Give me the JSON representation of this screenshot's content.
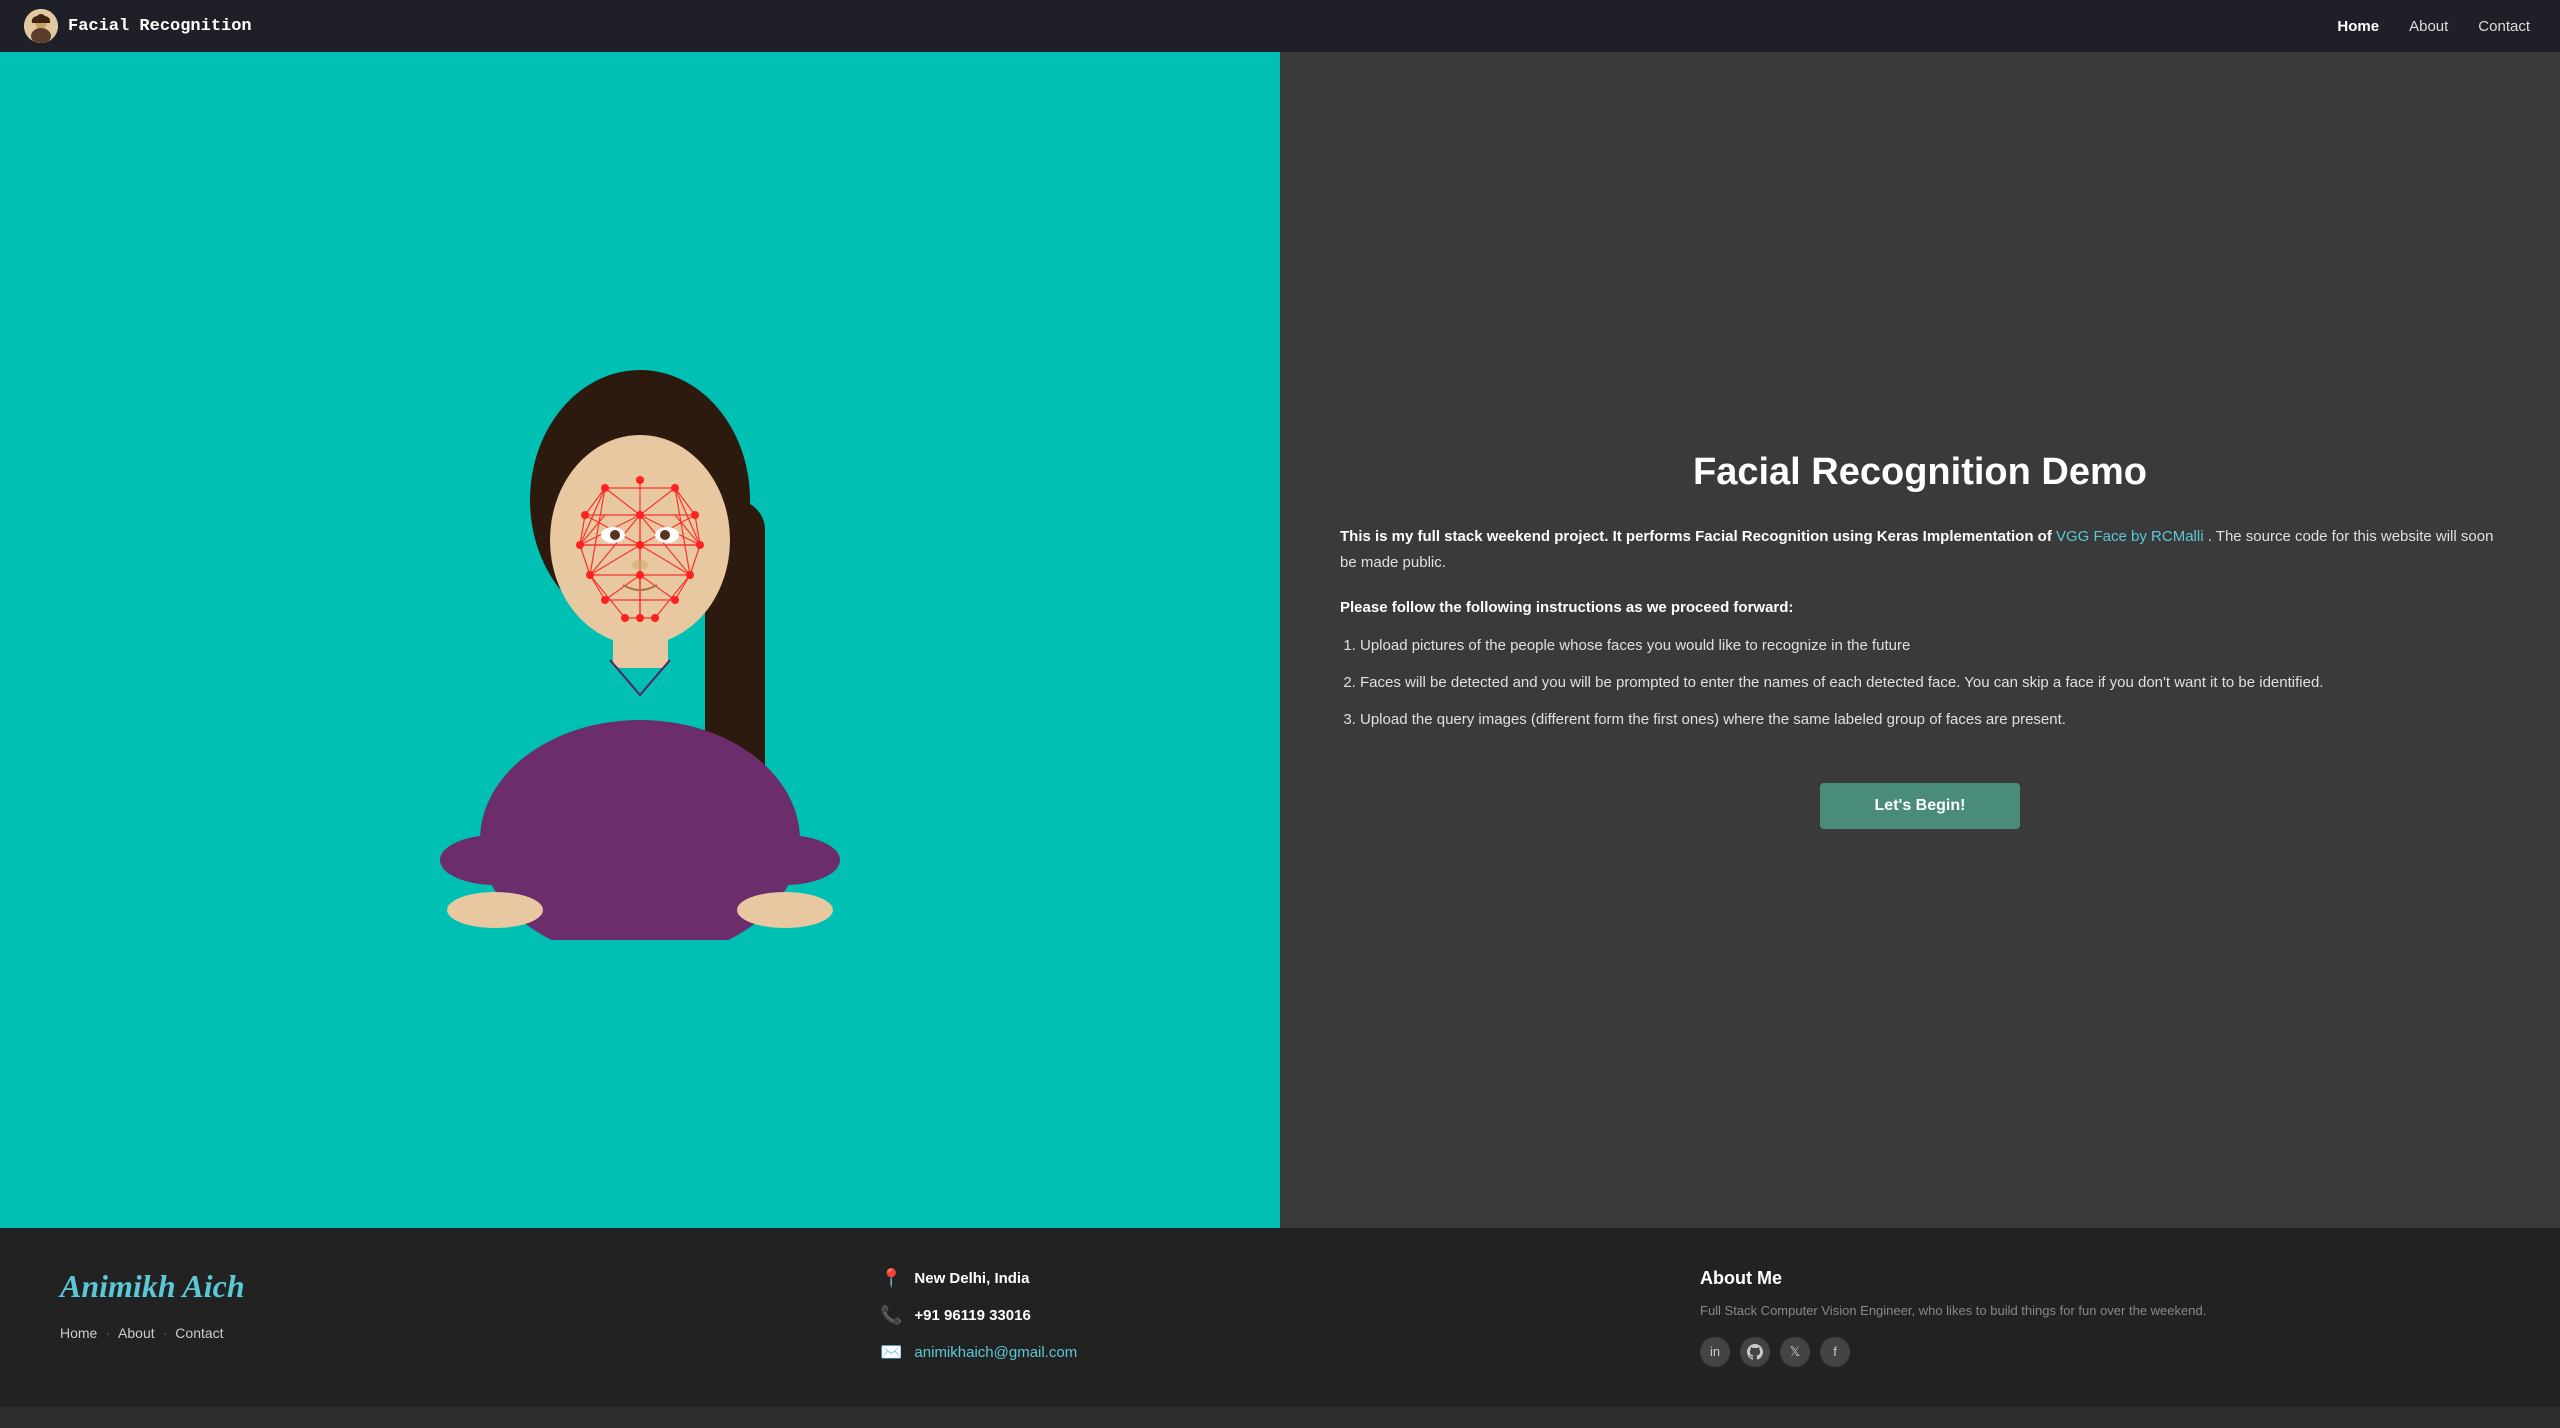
{
  "nav": {
    "brand": "Facial Recognition",
    "links": [
      {
        "label": "Home",
        "active": true
      },
      {
        "label": "About",
        "active": false
      },
      {
        "label": "Contact",
        "active": false
      }
    ]
  },
  "hero": {
    "title": "Facial Recognition Demo",
    "intro": "This is my full stack weekend project. It performs Facial Recognition using Keras Implementation of",
    "link_text": "VGG Face by RCMalli",
    "link_url": "#",
    "intro_suffix": ". The source code for this website will soon be made public.",
    "instructions_title": "Please follow the following instructions as we proceed forward:",
    "steps": [
      "Upload pictures of the people whose faces you would like to recognize in the future",
      "Faces will be detected and you will be prompted to enter the names of each detected face. You can skip a face if you don't want it to be identified.",
      "Upload the query images (different form the first ones) where the same labeled group of faces are present."
    ],
    "cta_label": "Let's Begin!"
  },
  "footer": {
    "brand_first": "Animikh",
    "brand_second": "Aich",
    "nav_links": [
      "Home",
      "About",
      "Contact"
    ],
    "contact": {
      "location": "New Delhi, India",
      "phone": "+91 96119 33016",
      "email": "animikhaich@gmail.com"
    },
    "about": {
      "title": "About Me",
      "description": "Full Stack Computer Vision Engineer, who likes to build things for fun over the weekend.",
      "social": [
        "in",
        "gh",
        "tw",
        "fb"
      ]
    }
  }
}
